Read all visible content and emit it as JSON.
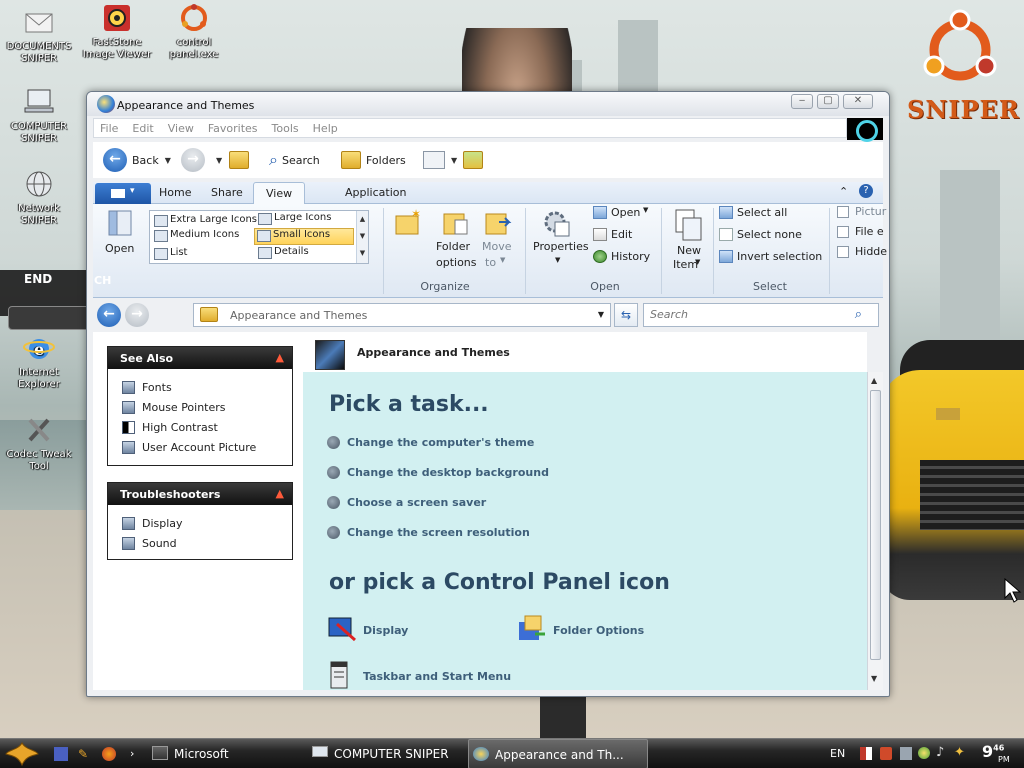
{
  "desktop": {
    "icons": [
      {
        "label": "DOCUMENTS\nSNIPER",
        "l1": "DOCUMENTS",
        "l2": "SNIPER"
      },
      {
        "l1": "FastStone",
        "l2": "Image Viewer"
      },
      {
        "l1": "control",
        "l2": "panel.exe"
      },
      {
        "l1": "COMPUTER",
        "l2": "SNIPER"
      },
      {
        "l1": "Network",
        "l2": "SNIPER"
      },
      {
        "l1": "Internet",
        "l2": "Explorer"
      },
      {
        "l1": "Codec Tweak",
        "l2": "Tool"
      }
    ],
    "brand_text": "SNIPER",
    "ghost_end": "END",
    "ghost_ch": "CH"
  },
  "window": {
    "title": "Appearance and Themes",
    "menu": [
      "File",
      "Edit",
      "View",
      "Favorites",
      "Tools",
      "Help"
    ],
    "nav": {
      "back": "Back",
      "search": "Search",
      "folders": "Folders"
    },
    "ribbon": {
      "tabs": [
        "Home",
        "Share",
        "View",
        "Application"
      ],
      "active_tab": "View",
      "pane_open": "Open",
      "layouts": [
        "Extra Large Icons",
        "Large Icons",
        "Medium Icons",
        "Small Icons",
        "List",
        "Details"
      ],
      "selected_layout": "Small Icons",
      "folder_options": {
        "l1": "Folder",
        "l2": "options"
      },
      "move_to": {
        "l1": "Move",
        "l2": "to"
      },
      "properties": "Properties",
      "open_group": {
        "open": "Open",
        "edit": "Edit",
        "history": "History"
      },
      "new_item": {
        "l1": "New",
        "l2": "Item"
      },
      "select_group": {
        "select_all": "Select all",
        "select_none": "Select none",
        "invert": "Invert selection"
      },
      "checkboxes": [
        "Pictur",
        "File e",
        "Hidde"
      ],
      "groups": {
        "organize": "Organize",
        "open": "Open",
        "select": "Select"
      }
    },
    "address": {
      "path": "Appearance and Themes",
      "search_placeholder": "Search"
    },
    "see_also": {
      "title": "See Also",
      "items": [
        "Fonts",
        "Mouse Pointers",
        "High Contrast",
        "User Account Picture"
      ]
    },
    "troubleshooters": {
      "title": "Troubleshooters",
      "items": [
        "Display",
        "Sound"
      ]
    },
    "main": {
      "category_title": "Appearance and Themes",
      "pick_task": "Pick a task...",
      "tasks": [
        "Change the computer's theme",
        "Change the desktop background",
        "Choose a screen saver",
        "Change the screen resolution"
      ],
      "pick_icon": "or pick a Control Panel icon",
      "icons": [
        "Display",
        "Folder Options",
        "Taskbar and Start Menu"
      ]
    }
  },
  "taskbar": {
    "items": [
      "Microsoft",
      "COMPUTER SNIPER",
      "Appearance and Th..."
    ],
    "lang": "EN",
    "clock": "9",
    "clock_min": "46",
    "ampm": "PM"
  }
}
